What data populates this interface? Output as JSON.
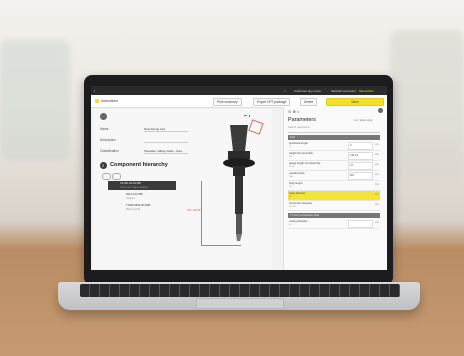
{
  "app": {
    "topbar": {
      "customer": "Customer any name",
      "user": "Sandvik Coromant",
      "username": "Test Admin"
    },
    "toolbar": {
      "app_title": "Assemblizer",
      "btn_print": "Print summary",
      "btn_export": "Export CPT package",
      "btn_delete": "Delete",
      "btn_save": "Save"
    },
    "form": {
      "name_label": "Name",
      "name_value": "New boring tool",
      "description_label": "Description",
      "description_value": "",
      "classification_label": "Classification",
      "classification_value": "Shoulder milling cutter - bore"
    },
    "hierarchy": {
      "step": "2",
      "title": "Component hierarchy",
      "items": [
        {
          "name": "C6-391.02-63 080",
          "sub": "Coromant Capto adaptor"
        },
        {
          "name": "391.14-12 080",
          "sub": "Adaptor"
        },
        {
          "name": "TT300-0500-05 A080",
          "sub": "Boring head"
        }
      ]
    },
    "dimension": "170 / 134.19",
    "parameters": {
      "title": "Parameters",
      "count": "4-1 / total empty",
      "search_placeholder": "Search parameters",
      "group_header": "Tool",
      "rows": [
        {
          "label": "functional length",
          "sub": "LF",
          "value": "2",
          "unit": "mm"
        },
        {
          "label": "weight incl assembly",
          "sub": "WT",
          "value": "134.44",
          "unit": "mm"
        },
        {
          "label": "gauge length incl assembly",
          "sub": "LFTR",
          "value": "47",
          "unit": "mm"
        },
        {
          "label": "overall length",
          "sub": "OAL",
          "value": "827",
          "unit": "mm"
        },
        {
          "label": "body length",
          "sub": "LB",
          "value": "",
          "unit": "mm"
        },
        {
          "label": "body diameter",
          "sub": "BD",
          "value": "",
          "unit": "mm",
          "highlight": true
        },
        {
          "label": "connection diameter",
          "sub": "DCON",
          "value": "",
          "unit": "mm"
        }
      ],
      "group_header_2": "TT-conn connection code",
      "last_row": {
        "label": "cutting diameter",
        "sub": "DC",
        "value": "",
        "unit": "mm"
      }
    }
  },
  "colors": {
    "accent": "#f2e02d",
    "dark": "#2b2b2b",
    "dimension": "#e06b6b"
  }
}
